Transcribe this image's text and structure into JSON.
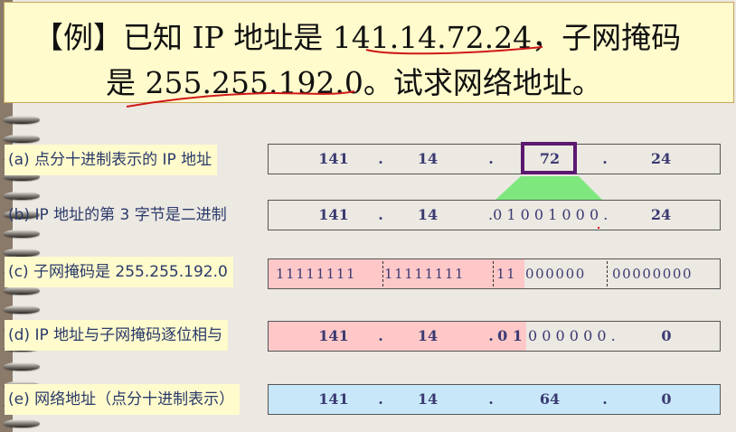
{
  "title": {
    "line1": "【例】已知 IP 地址是 141.14.72.24，子网掩码",
    "line2": "是 255.255.192.0。试求网络地址。"
  },
  "rows": [
    {
      "label": "(a) 点分十进制表示的 IP 地址",
      "octets": [
        "141",
        ".",
        "14",
        ".",
        "72",
        ".",
        "24"
      ]
    },
    {
      "label": "(b) IP 地址的第 3 字节是二进制",
      "octets": [
        "141",
        ".",
        "14",
        ".0 1 0 0 1 0 0 0 .",
        "24"
      ]
    },
    {
      "label": "(c) 子网掩码是 255.255.192.0",
      "bits": [
        "11111111",
        "11111111",
        "11",
        "000000",
        "00000000"
      ]
    },
    {
      "label": "(d) IP 地址与子网掩码逐位相与",
      "octets": [
        "141",
        ".",
        "14",
        ".",
        "0 1",
        "0 0 0 0 0 0 .",
        "0"
      ]
    },
    {
      "label": "(e) 网络地址（点分十进制表示）",
      "octets": [
        "141",
        ".",
        "14",
        ".",
        "64",
        ".",
        "0"
      ]
    }
  ],
  "colors": {
    "title_bg": "#fffbcc",
    "highlight_box": "#5b1a70",
    "trapezoid": "#7ee87e",
    "pink": "#ffc8c8",
    "blue": "#c8e8fa",
    "text": "#3a3a72"
  }
}
